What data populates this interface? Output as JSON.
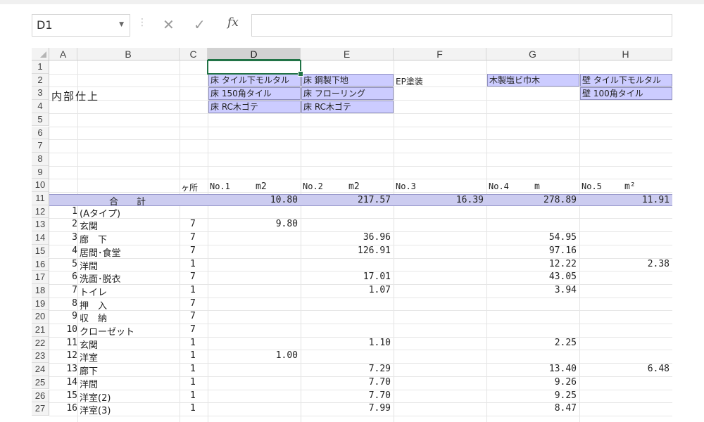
{
  "name_box": "D1",
  "formula_bar": {
    "value": ""
  },
  "columns": [
    "A",
    "B",
    "C",
    "D",
    "E",
    "F",
    "G",
    "H"
  ],
  "selected_column": "D",
  "rows": [
    "1",
    "2",
    "3",
    "4",
    "5",
    "6",
    "7",
    "8",
    "9",
    "10",
    "11",
    "12",
    "13",
    "14",
    "15",
    "16",
    "17",
    "18",
    "19",
    "20",
    "21",
    "22",
    "23",
    "24",
    "25",
    "26",
    "27"
  ],
  "title": "内部仕上",
  "labels": {
    "d2": "床 タイル下モルタル",
    "d3": "床 150角タイル",
    "d4": "床 RC木ゴテ",
    "e2": "床 鋼製下地",
    "e3": "床 フローリング",
    "e4": "床 RC木ゴテ",
    "f2": "EP塗装",
    "g2": "木製塩ビ巾木",
    "h2": "壁 タイル下モルタル",
    "h3": "壁 100角タイル"
  },
  "header_row": {
    "c": "ヶ所",
    "d_no": "No.1",
    "d_unit": "m2",
    "e_no": "No.2",
    "e_unit": "m2",
    "f_no": "No.3",
    "g_no": "No.4",
    "g_unit": "m",
    "h_no": "No.5",
    "h_unit": "m²"
  },
  "totals": {
    "label": "合　　計",
    "d": "10.80",
    "e": "217.57",
    "f": "16.39",
    "g": "278.89",
    "h": "11.91"
  },
  "items": [
    {
      "a": "1",
      "b": "(Aタイプ)",
      "c": "",
      "d": "",
      "e": "",
      "g": "",
      "h": ""
    },
    {
      "a": "2",
      "b": "玄関",
      "c": "7",
      "d": "9.80",
      "e": "",
      "g": "",
      "h": ""
    },
    {
      "a": "3",
      "b": "廊　下",
      "c": "7",
      "d": "",
      "e": "36.96",
      "g": "54.95",
      "h": ""
    },
    {
      "a": "4",
      "b": "居間･食堂",
      "c": "7",
      "d": "",
      "e": "126.91",
      "g": "97.16",
      "h": ""
    },
    {
      "a": "5",
      "b": "洋間",
      "c": "1",
      "d": "",
      "e": "",
      "g": "12.22",
      "h": "2.38"
    },
    {
      "a": "6",
      "b": "洗面･脱衣",
      "c": "7",
      "d": "",
      "e": "17.01",
      "g": "43.05",
      "h": ""
    },
    {
      "a": "7",
      "b": "トイレ",
      "c": "1",
      "d": "",
      "e": "1.07",
      "g": "3.94",
      "h": ""
    },
    {
      "a": "8",
      "b": "押　入",
      "c": "7",
      "d": "",
      "e": "",
      "g": "",
      "h": ""
    },
    {
      "a": "9",
      "b": "収　納",
      "c": "7",
      "d": "",
      "e": "",
      "g": "",
      "h": ""
    },
    {
      "a": "10",
      "b": "クローゼット",
      "c": "7",
      "d": "",
      "e": "",
      "g": "",
      "h": ""
    },
    {
      "a": "11",
      "b": "玄関",
      "c": "1",
      "d": "",
      "e": "1.10",
      "g": "2.25",
      "h": ""
    },
    {
      "a": "12",
      "b": "洋室",
      "c": "1",
      "d": "1.00",
      "e": "",
      "g": "",
      "h": ""
    },
    {
      "a": "13",
      "b": "廊下",
      "c": "1",
      "d": "",
      "e": "7.29",
      "g": "13.40",
      "h": "6.48"
    },
    {
      "a": "14",
      "b": "洋間",
      "c": "1",
      "d": "",
      "e": "7.70",
      "g": "9.26",
      "h": ""
    },
    {
      "a": "15",
      "b": "洋室(2)",
      "c": "1",
      "d": "",
      "e": "7.70",
      "g": "9.25",
      "h": ""
    },
    {
      "a": "16",
      "b": "洋室(3)",
      "c": "1",
      "d": "",
      "e": "7.99",
      "g": "8.47",
      "h": ""
    }
  ]
}
